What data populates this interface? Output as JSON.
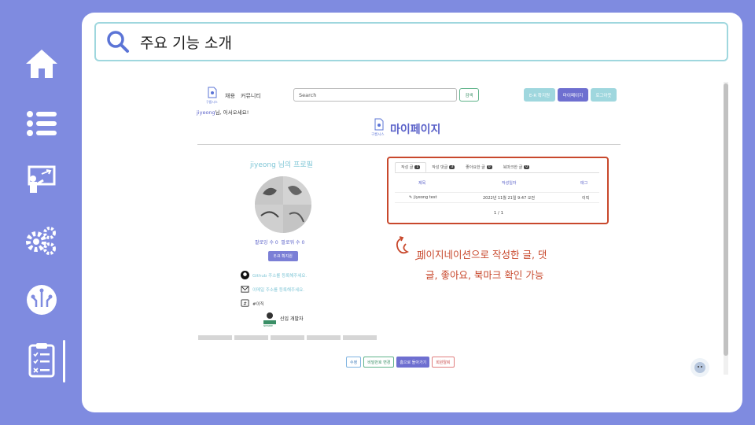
{
  "sidebar": {
    "icons": [
      "home-icon",
      "list-icon",
      "presentation-icon",
      "settings-gears-icon",
      "circuit-brain-icon",
      "clipboard-checklist-icon"
    ],
    "active": "clipboard-checklist-icon"
  },
  "search": {
    "value": "주요 기능 소개"
  },
  "site": {
    "logo_text": "구름시스",
    "nav_links": [
      "채용",
      "커뮤니티"
    ],
    "search_placeholder": "Search",
    "search_button": "검색",
    "buttons": [
      "E-R 확지원",
      "마이페이지",
      "로그아웃"
    ],
    "welcome_user": "jiyeong",
    "welcome_suffix": "님, 어서오세요!",
    "page_title": "마이페이지"
  },
  "profile": {
    "title": "jiyeong 님의 프로필",
    "following": "팔로잉 수 0",
    "followers": "팔로워 수 0",
    "profile_button": "E-R 확지원",
    "github": "Github 주소를 등록해주세요.",
    "email": "이메일 주소를 등록해주세요.",
    "tag": "#이직",
    "badge": "신입 개발자",
    "badge_icon_text": "NEWBIE"
  },
  "panel": {
    "tabs": [
      {
        "label": "작성 글",
        "count": "1"
      },
      {
        "label": "작성 댓글",
        "count": "3"
      },
      {
        "label": "좋아요한 글",
        "count": "0"
      },
      {
        "label": "북마크한 글",
        "count": "0"
      }
    ],
    "headers": [
      "제목",
      "작성일자",
      "태그"
    ],
    "rows": [
      {
        "title": "jiyeong test",
        "date": "2022년 11월 21일 9:47 오전",
        "tag": "이직"
      }
    ],
    "page": "1 / 1"
  },
  "annotation": {
    "line1": "페이지네이션으로 작성한 글, 댓",
    "line2": "글, 좋아요, 북마크 확인 가능"
  },
  "bottom_buttons": [
    "수정",
    "비밀번호 변경",
    "홈으로 돌아가기",
    "회원탈퇴"
  ],
  "colors": {
    "background": "#7f8be0",
    "accent": "#5b62c9",
    "annotation": "#c8482c",
    "teal": "#7fc6d6"
  }
}
